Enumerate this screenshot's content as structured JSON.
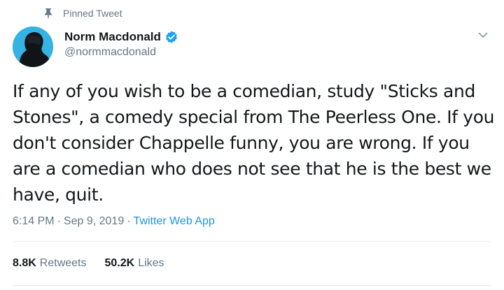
{
  "pinned": {
    "label": "Pinned Tweet",
    "icon": "pin-icon"
  },
  "author": {
    "name": "Norm Macdonald",
    "handle": "@normmacdonald",
    "verified_icon": "verified-badge-icon",
    "avatar_bg": "#34b3e4"
  },
  "tweet": {
    "text": "If any of you wish to be a comedian, study \"Sticks and Stones\", a comedy special from The Peerless One. If you don't consider Chappelle funny, you are wrong. If you are a comedian who does not see that he is the best we have, quit."
  },
  "meta": {
    "time": "6:14 PM",
    "date": "Sep 9, 2019",
    "separator": "·",
    "source": "Twitter Web App"
  },
  "stats": {
    "retweets_count": "8.8K",
    "retweets_label": "Retweets",
    "likes_count": "50.2K",
    "likes_label": "Likes"
  },
  "colors": {
    "text": "#14171a",
    "secondary": "#657786",
    "link": "#1b95e0",
    "verified": "#1da1f2",
    "divider": "#e6ecf0"
  }
}
